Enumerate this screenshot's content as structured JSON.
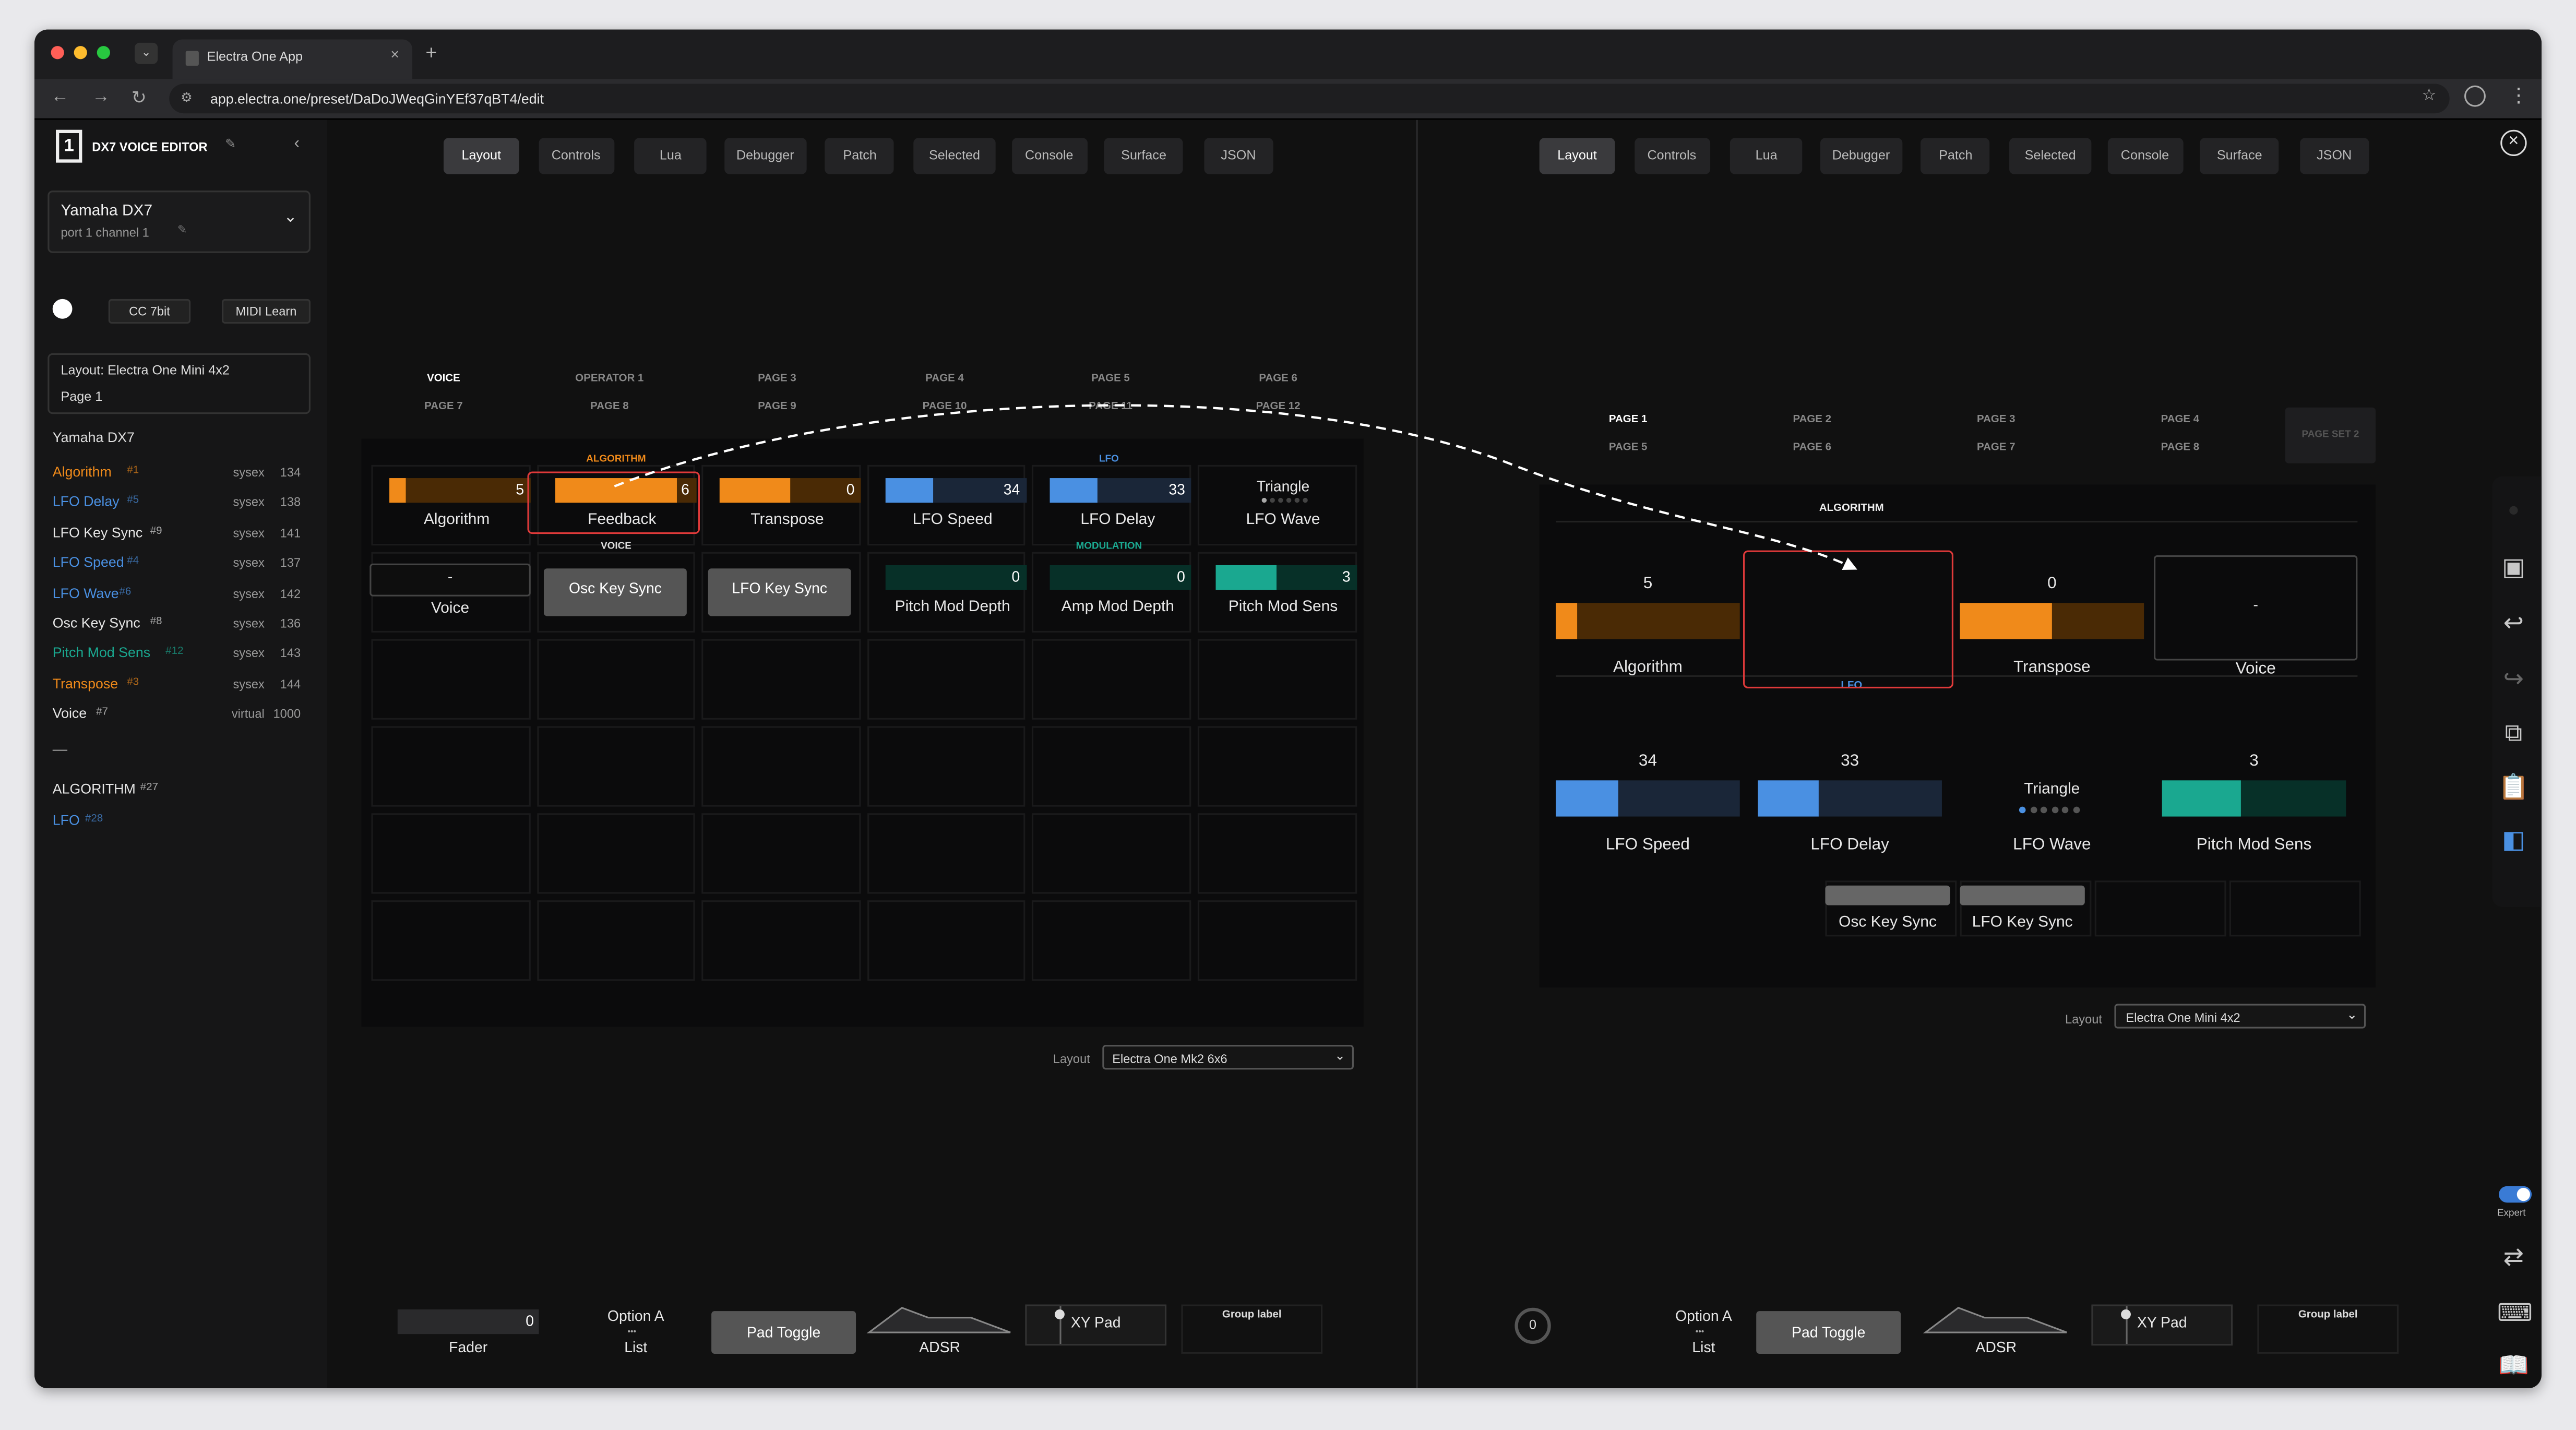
{
  "browser": {
    "tab_title": "Electra One App",
    "url": "app.electra.one/preset/DaDoJWeqGinYEf37qBT4/edit",
    "new_tab": "+",
    "close_tab": "×"
  },
  "sidebar": {
    "title": "DX7 VOICE EDITOR",
    "device_name": "Yamaha DX7",
    "device_port": "port 1 channel 1",
    "cc_mode": "CC 7bit",
    "midi_learn": "MIDI Learn",
    "layout_info": "Layout: Electra One Mini 4x2",
    "page_info": "Page 1",
    "section": "Yamaha DX7",
    "params": [
      {
        "name": "Algorithm",
        "num": "#1",
        "type": "sysex",
        "value": "134",
        "color": "#f08a1a"
      },
      {
        "name": "LFO Delay",
        "num": "#5",
        "type": "sysex",
        "value": "138",
        "color": "#4a90e2"
      },
      {
        "name": "LFO Key Sync",
        "num": "#9",
        "type": "sysex",
        "value": "141",
        "color": "#e6e6e6"
      },
      {
        "name": "LFO Speed",
        "num": "#4",
        "type": "sysex",
        "value": "137",
        "color": "#4a90e2"
      },
      {
        "name": "LFO Wave",
        "num": "#6",
        "type": "sysex",
        "value": "142",
        "color": "#4a90e2"
      },
      {
        "name": "Osc Key Sync",
        "num": "#8",
        "type": "sysex",
        "value": "136",
        "color": "#e6e6e6"
      },
      {
        "name": "Pitch Mod Sens",
        "num": "#12",
        "type": "sysex",
        "value": "143",
        "color": "#1aa890"
      },
      {
        "name": "Transpose",
        "num": "#3",
        "type": "sysex",
        "value": "144",
        "color": "#f08a1a"
      },
      {
        "name": "Voice",
        "num": "#7",
        "type": "virtual",
        "value": "1000",
        "color": "#e6e6e6"
      }
    ],
    "separator": "—",
    "groups": [
      {
        "name": "ALGORITHM",
        "num": "#27",
        "color": "#e6e6e6"
      },
      {
        "name": "LFO",
        "num": "#28",
        "color": "#4a90e2"
      }
    ]
  },
  "toolbar": {
    "tabs": [
      "Layout",
      "Controls",
      "Lua",
      "Debugger",
      "Patch",
      "Selected",
      "Console",
      "Surface",
      "JSON"
    ],
    "active": "Layout"
  },
  "left_panel": {
    "pages_row1": [
      "VOICE",
      "OPERATOR 1",
      "PAGE 3",
      "PAGE 4",
      "PAGE 5",
      "PAGE 6"
    ],
    "pages_row2": [
      "PAGE 7",
      "PAGE 8",
      "PAGE 9",
      "PAGE 10",
      "PAGE 11",
      "PAGE 12"
    ],
    "group_algorithm": "ALGORITHM",
    "group_lfo": "LFO",
    "group_voice": "VOICE",
    "group_modulation": "MODULATION",
    "controls": {
      "algorithm": {
        "label": "Algorithm",
        "value": "5",
        "fill": 0.12
      },
      "feedback": {
        "label": "Feedback",
        "value": "6",
        "fill": 0.86
      },
      "transpose": {
        "label": "Transpose",
        "value": "0",
        "fill": 0.5
      },
      "lfo_speed": {
        "label": "LFO Speed",
        "value": "34",
        "fill": 0.34
      },
      "lfo_delay": {
        "label": "LFO Delay",
        "value": "33",
        "fill": 0.33
      },
      "lfo_wave": {
        "label": "LFO Wave",
        "value": "Triangle"
      },
      "voice": {
        "label": "Voice",
        "value": "-"
      },
      "osc_key_sync": {
        "label": "Osc Key Sync"
      },
      "lfo_key_sync": {
        "label": "LFO Key Sync"
      },
      "pitch_mod_depth": {
        "label": "Pitch Mod Depth",
        "value": "0"
      },
      "amp_mod_depth": {
        "label": "Amp Mod Depth",
        "value": "0"
      },
      "pitch_mod_sens": {
        "label": "Pitch Mod Sens",
        "value": "3",
        "fill": 0.43
      }
    },
    "layout_label": "Layout",
    "layout_value": "Electra One Mk2 6x6"
  },
  "right_panel": {
    "pages_row1": [
      "PAGE 1",
      "PAGE 2",
      "PAGE 3",
      "PAGE 4"
    ],
    "pages_row2": [
      "PAGE 5",
      "PAGE 6",
      "PAGE 7",
      "PAGE 8"
    ],
    "page_set": "PAGE SET 2",
    "group_algorithm": "ALGORITHM",
    "group_lfo": "LFO",
    "controls": {
      "algorithm": {
        "label": "Algorithm",
        "value": "5",
        "fill": 0.12
      },
      "transpose": {
        "label": "Transpose",
        "value": "0",
        "fill": 0.5
      },
      "voice": {
        "label": "Voice",
        "value": "-"
      },
      "lfo_speed": {
        "label": "LFO Speed",
        "value": "34",
        "fill": 0.34
      },
      "lfo_delay": {
        "label": "LFO Delay",
        "value": "33",
        "fill": 0.33
      },
      "lfo_wave": {
        "label": "LFO Wave",
        "value": "Triangle"
      },
      "pitch_mod_sens": {
        "label": "Pitch Mod Sens",
        "value": "3",
        "fill": 0.43
      },
      "osc_key_sync": {
        "label": "Osc Key Sync"
      },
      "lfo_key_sync": {
        "label": "LFO Key Sync"
      }
    },
    "layout_label": "Layout",
    "layout_value": "Electra One Mini 4x2"
  },
  "palette": {
    "fader_label": "Fader",
    "fader_value": "0",
    "knob_value": "0",
    "list_option": "Option A",
    "list_label": "List",
    "pad_toggle": "Pad Toggle",
    "adsr": "ADSR",
    "xy_pad": "XY Pad",
    "group_label": "Group label"
  },
  "right_rail": {
    "expert_label": "Expert",
    "expert_on": true
  },
  "colors": {
    "orange": "#f08a1a",
    "orange_dark": "#4a2a05",
    "blue": "#4a90e2",
    "blue_dark": "#1a2638",
    "teal": "#1aa890",
    "teal_dark": "#073028",
    "highlight": "#e03a3a"
  }
}
